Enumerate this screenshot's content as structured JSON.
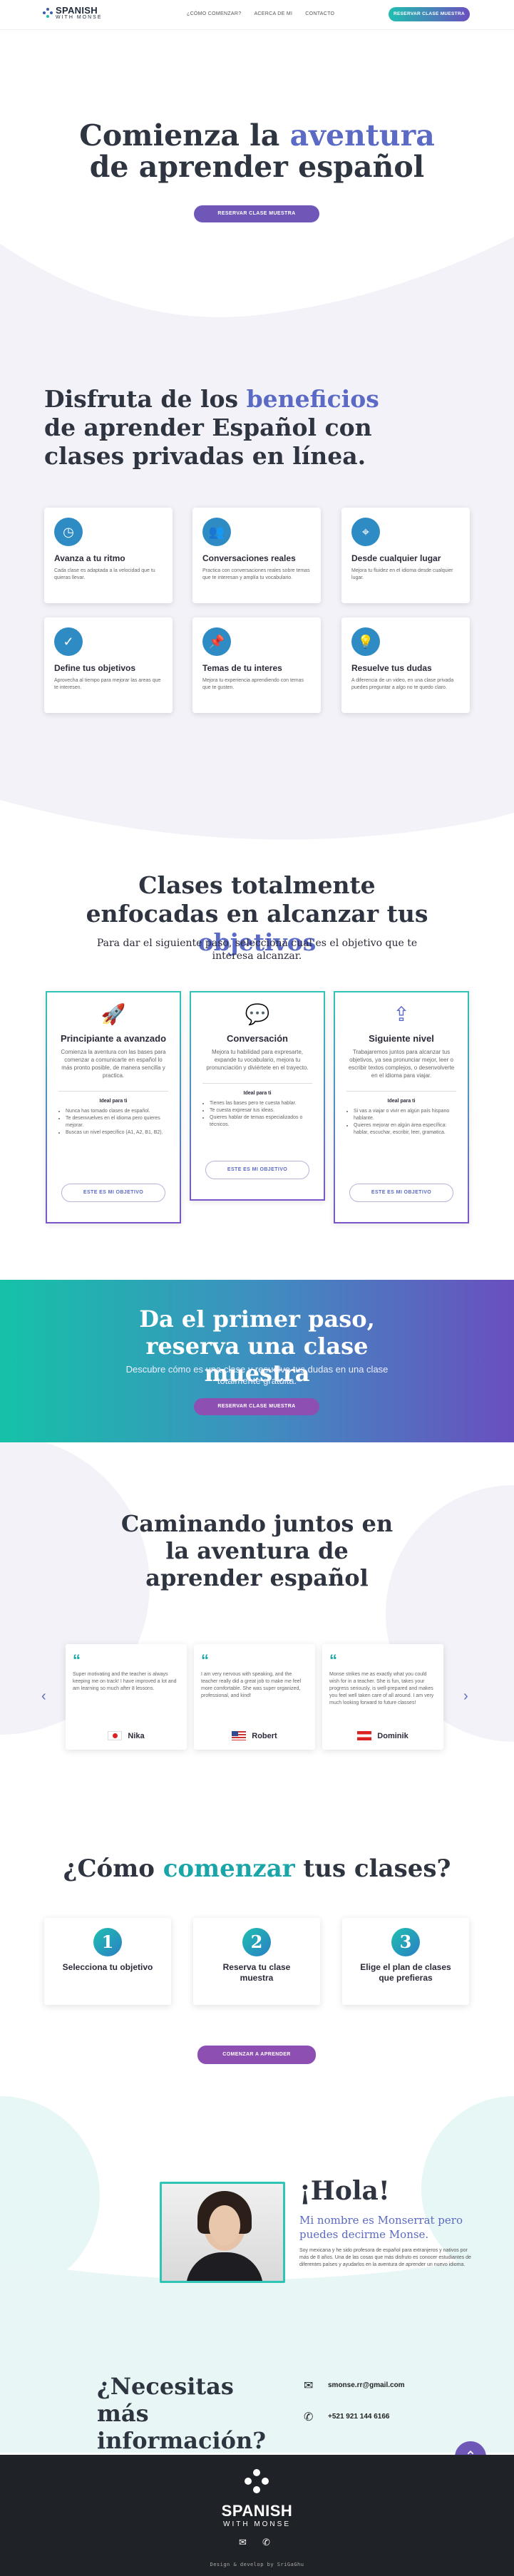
{
  "header": {
    "logo_main": "SPANISH",
    "logo_sub": "WITH MONSE",
    "nav": [
      "¿CÓMO COMENZAR?",
      "ACERCA DE MI",
      "CONTACTO"
    ],
    "cta": "RESERVAR CLASE MUESTRA"
  },
  "hero": {
    "title_a": "Comienza la ",
    "title_accent": "aventura",
    "title_b": "de aprender español",
    "cta": "RESERVAR CLASE MUESTRA"
  },
  "benefits": {
    "title_a": "Disfruta de los ",
    "title_accent": "beneficios",
    "title_b": " de aprender Español con clases privadas en línea.",
    "cards": [
      {
        "icon": "clock-icon",
        "glyph": "◷",
        "title": "Avanza a tu ritmo",
        "text": "Cada clase es adaptada a la velocidad que tu quieras llevar."
      },
      {
        "icon": "users-icon",
        "glyph": "👥",
        "title": "Conversaciones reales",
        "text": "Practica con conversaciones reales sobre temas que te interesan y amplía tu vocabulario."
      },
      {
        "icon": "location-icon",
        "glyph": "⌖",
        "title": "Desde cualquier lugar",
        "text": "Mejora tu fluidez en el idioma desde cualquier lugar."
      },
      {
        "icon": "check-circle-icon",
        "glyph": "✓",
        "title": "Define tus objetivos",
        "text": "Aprovecha al tiempo para mejorar las areas que te interesen."
      },
      {
        "icon": "pin-icon",
        "glyph": "📌",
        "title": "Temas de tu interes",
        "text": "Mejora tu experiencia aprendiendo con temas que te gusten."
      },
      {
        "icon": "lightbulb-icon",
        "glyph": "💡",
        "title": "Resuelve tus dudas",
        "text": "A diferencia de un video, en una clase privada puedes preguntar a algo no te quedo claro."
      }
    ]
  },
  "levels": {
    "title_a": "Clases totalmente enfocadas en alcanzar tus ",
    "title_accent": "objetivos",
    "subtitle": "Para dar el siguiente paso, selecciona cual es el objetivo que te interesa alcanzar.",
    "cards": [
      {
        "icon": "rocket-icon",
        "glyph": "🚀",
        "title": "Principiante a avanzado",
        "text": "Comienza la aventura con las bases para comenzar a comunicarte en español lo más pronto posible, de manera sencilla y practica.",
        "ideal": "Ideal para ti",
        "items": [
          "Nunca has tomado clases de español.",
          "Te desenvuelves en el idioma pero quieres mejorar.",
          "Buscas un nivel específico (A1, A2, B1, B2)."
        ],
        "button": "ESTE ES MI OBJETIVO"
      },
      {
        "icon": "chat-icon",
        "glyph": "💬",
        "title": "Conversación",
        "text": "Mejora tu habilidad para expresarte, expande tu vocabulario, mejora tu pronunciación y diviértete en el trayecto.",
        "ideal": "Ideal para ti",
        "items": [
          "Tienes las bases pero te cuesta hablar.",
          "Te cuesta expresar tus ideas.",
          "Quieres hablar de temas especializados o técnicos."
        ],
        "button": "ESTE ES MI OBJETIVO"
      },
      {
        "icon": "next-level-icon",
        "glyph": "⇪",
        "title": "Siguiente nivel",
        "text": "Trabajaremos juntos para alcanzar tus objetivos, ya sea pronunciar mejor, leer o escribir textos complejos, o desenvolverte en el idioma para viajar.",
        "ideal": "Ideal para ti",
        "items": [
          "Si vas a viajar o vivir en algún país hispano hablante.",
          "Quieres mejorar en algún área específica: hablar, escuchar, escribir, leer, gramatica."
        ],
        "button": "ESTE ES MI OBJETIVO"
      }
    ]
  },
  "banner": {
    "title": "Da el primer paso, reserva una clase muestra",
    "text": "Descubre cómo es una clase y resuelve tus dudas en una clase totalmente gratuita.",
    "cta": "RESERVAR CLASE MUESTRA"
  },
  "testimonials": {
    "title": "Caminando juntos en la aventura de aprender español",
    "items": [
      {
        "text": "Super motivating and the teacher is always keeping me on track! I have improved a lot and am learning so much after 8 lessons.",
        "name": "Nika",
        "flag": "japan"
      },
      {
        "text": "I am very nervous with speaking, and the teacher really did a great job to make me feel more comfortable. She was super organized, professional, and kind!",
        "name": "Robert",
        "flag": "usa"
      },
      {
        "text": "Monse strikes me as exactly what you could wish for in a teacher. She is fun, takes your progress seriously, is well-prepared and makes you feel well taken care of all around. I am very much looking forward to future classes!",
        "name": "Dominik",
        "flag": "austria"
      }
    ]
  },
  "steps": {
    "title_a": "¿Cómo ",
    "title_accent": "comenzar",
    "title_b": " tus clases?",
    "items": [
      {
        "num": "1",
        "title": "Selecciona tu objetivo"
      },
      {
        "num": "2",
        "title": "Reserva tu clase muestra"
      },
      {
        "num": "3",
        "title": "Elige el plan de clases que prefieras"
      }
    ],
    "cta": "COMENZAR A APRENDER"
  },
  "about": {
    "title": "¡Hola!",
    "subtitle": "Mi nombre es Monserrat pero puedes decirme Monse.",
    "text": "Soy mexicana y he sido profesora de español para extranjeros y nativos por más de 8 años. Una de las cosas que más disfruto es conocer estudiantes de diferentes países y ayudarlos en la aventura de aprender un nuevo idioma."
  },
  "contact": {
    "title": "¿Necesitas más información?",
    "email": "smonse.rr@gmail.com",
    "phone": "+521 921 144 6166"
  },
  "footer": {
    "logo_main": "SPANISH",
    "logo_sub": "WITH MONSE",
    "credit": "Design & develop by SriGaGhu"
  },
  "colors": {
    "accent": "#5b6ac4",
    "teal": "#1aa6a8",
    "purple": "#8e4fb3",
    "footer": "#1f2226"
  }
}
